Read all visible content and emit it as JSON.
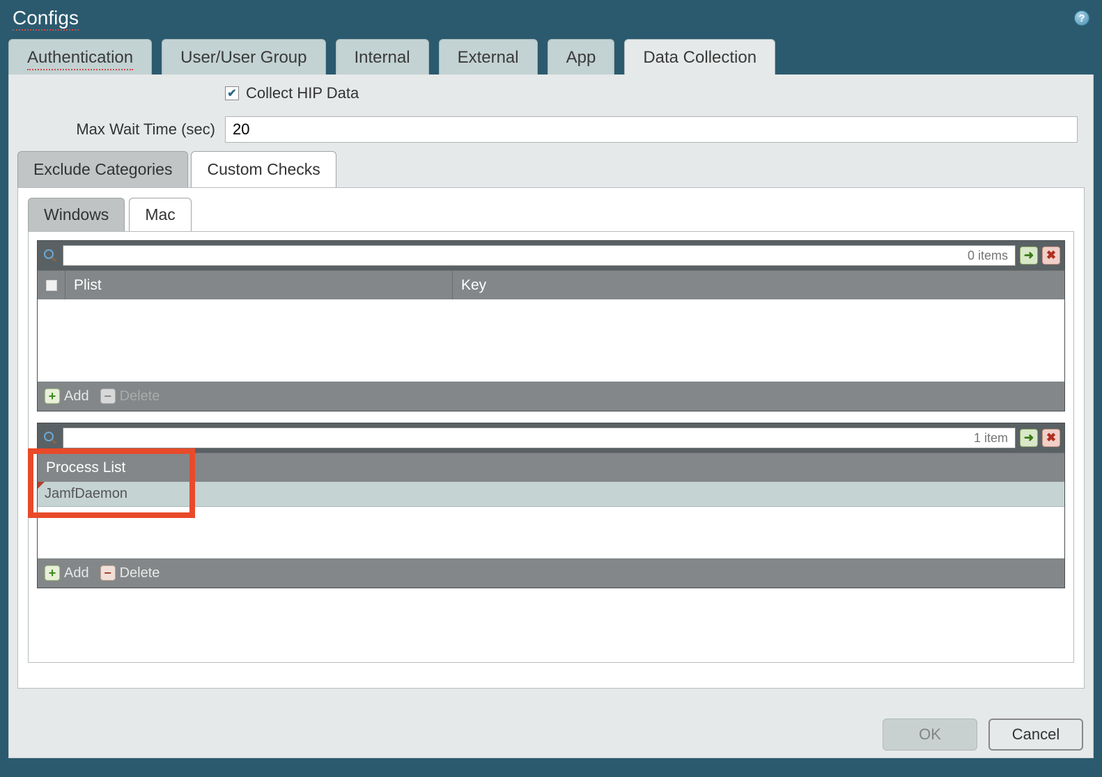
{
  "title": "Configs",
  "tabs": [
    "Authentication",
    "User/User Group",
    "Internal",
    "External",
    "App",
    "Data Collection"
  ],
  "active_tab": 5,
  "collect_hip_label": "Collect HIP Data",
  "collect_hip_checked": true,
  "max_wait_label": "Max Wait Time (sec)",
  "max_wait_value": "20",
  "subtabs": [
    "Exclude Categories",
    "Custom Checks"
  ],
  "active_subtab": 1,
  "ostabs": [
    "Windows",
    "Mac"
  ],
  "active_ostab": 1,
  "grid1": {
    "items_text": "0 items",
    "columns": [
      "Plist",
      "Key"
    ],
    "rows": [],
    "add_label": "Add",
    "delete_label": "Delete"
  },
  "grid2": {
    "items_text": "1 item",
    "columns": [
      "Process List"
    ],
    "rows": [
      "JamfDaemon"
    ],
    "add_label": "Add",
    "delete_label": "Delete"
  },
  "buttons": {
    "ok": "OK",
    "cancel": "Cancel"
  }
}
